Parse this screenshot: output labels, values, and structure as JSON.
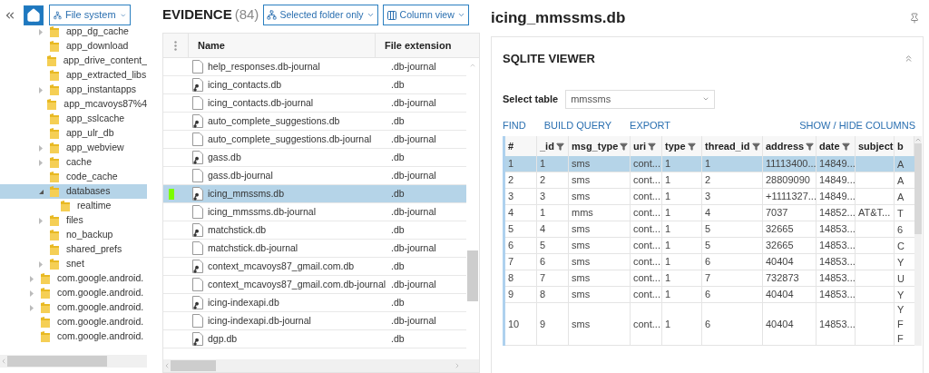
{
  "left_panel": {
    "view_selector": "File system",
    "tree": {
      "inner_items": [
        {
          "label": "app_dg_cache",
          "expandable": true,
          "expanded": false,
          "selected": false
        },
        {
          "label": "app_download",
          "expandable": false,
          "expanded": false,
          "selected": false
        },
        {
          "label": "app_drive_content_",
          "expandable": false,
          "expanded": false,
          "selected": false
        },
        {
          "label": "app_extracted_libs",
          "expandable": false,
          "expanded": false,
          "selected": false
        },
        {
          "label": "app_instantapps",
          "expandable": true,
          "expanded": false,
          "selected": false
        },
        {
          "label": "app_mcavoys87%4",
          "expandable": false,
          "expanded": false,
          "selected": false
        },
        {
          "label": "app_sslcache",
          "expandable": false,
          "expanded": false,
          "selected": false
        },
        {
          "label": "app_ulr_db",
          "expandable": false,
          "expanded": false,
          "selected": false
        },
        {
          "label": "app_webview",
          "expandable": true,
          "expanded": false,
          "selected": false
        },
        {
          "label": "cache",
          "expandable": true,
          "expanded": false,
          "selected": false
        },
        {
          "label": "code_cache",
          "expandable": false,
          "expanded": false,
          "selected": false
        },
        {
          "label": "databases",
          "expandable": true,
          "expanded": true,
          "selected": true,
          "children": [
            {
              "label": "realtime",
              "expandable": false,
              "expanded": false,
              "selected": false
            }
          ]
        },
        {
          "label": "files",
          "expandable": true,
          "expanded": false,
          "selected": false
        },
        {
          "label": "no_backup",
          "expandable": false,
          "expanded": false,
          "selected": false
        },
        {
          "label": "shared_prefs",
          "expandable": false,
          "expanded": false,
          "selected": false
        },
        {
          "label": "snet",
          "expandable": true,
          "expanded": false,
          "selected": false
        }
      ],
      "outer_items": [
        {
          "label": "com.google.android.",
          "expandable": true,
          "expanded": false,
          "selected": false
        },
        {
          "label": "com.google.android.",
          "expandable": true,
          "expanded": false,
          "selected": false
        },
        {
          "label": "com.google.android.",
          "expandable": true,
          "expanded": false,
          "selected": false
        },
        {
          "label": "com.google.android.",
          "expandable": false,
          "expanded": false,
          "selected": false
        },
        {
          "label": "com.google.android.",
          "expandable": false,
          "expanded": false,
          "selected": false
        }
      ]
    }
  },
  "evidence": {
    "title": "EVIDENCE",
    "count": "(84)",
    "scope_selector": "Selected folder only",
    "view_selector": "Column view",
    "columns": [
      "Name",
      "File extension"
    ],
    "rows": [
      {
        "name": "help_responses.db-journal",
        "extension": ".db-journal",
        "kind": "plain",
        "selected": false,
        "flagged": false
      },
      {
        "name": "icing_contacts.db",
        "extension": ".db",
        "kind": "database",
        "selected": false,
        "flagged": false
      },
      {
        "name": "icing_contacts.db-journal",
        "extension": ".db-journal",
        "kind": "plain",
        "selected": false,
        "flagged": false
      },
      {
        "name": "auto_complete_suggestions.db",
        "extension": ".db",
        "kind": "database",
        "selected": false,
        "flagged": false
      },
      {
        "name": "auto_complete_suggestions.db-journal",
        "extension": ".db-journal",
        "kind": "plain",
        "selected": false,
        "flagged": false
      },
      {
        "name": "gass.db",
        "extension": ".db",
        "kind": "database",
        "selected": false,
        "flagged": false
      },
      {
        "name": "gass.db-journal",
        "extension": ".db-journal",
        "kind": "plain",
        "selected": false,
        "flagged": false
      },
      {
        "name": "icing_mmssms.db",
        "extension": ".db",
        "kind": "database",
        "selected": true,
        "flagged": true
      },
      {
        "name": "icing_mmssms.db-journal",
        "extension": ".db-journal",
        "kind": "plain",
        "selected": false,
        "flagged": false
      },
      {
        "name": "matchstick.db",
        "extension": ".db",
        "kind": "database",
        "selected": false,
        "flagged": false
      },
      {
        "name": "matchstick.db-journal",
        "extension": ".db-journal",
        "kind": "plain",
        "selected": false,
        "flagged": false
      },
      {
        "name": "context_mcavoys87_gmail.com.db",
        "extension": ".db",
        "kind": "database",
        "selected": false,
        "flagged": false
      },
      {
        "name": "context_mcavoys87_gmail.com.db-journal",
        "extension": ".db-journal",
        "kind": "plain",
        "selected": false,
        "flagged": false
      },
      {
        "name": "icing-indexapi.db",
        "extension": ".db",
        "kind": "database",
        "selected": false,
        "flagged": false
      },
      {
        "name": "icing-indexapi.db-journal",
        "extension": ".db-journal",
        "kind": "plain",
        "selected": false,
        "flagged": false
      },
      {
        "name": "dgp.db",
        "extension": ".db",
        "kind": "database",
        "selected": false,
        "flagged": false
      }
    ]
  },
  "detail": {
    "title": "icing_mmssms.db",
    "viewer": {
      "title": "SQLITE VIEWER",
      "select_label": "Select table",
      "select_value": "mmssms",
      "actions": [
        "FIND",
        "BUILD QUERY",
        "EXPORT"
      ],
      "columns_action": "SHOW / HIDE COLUMNS",
      "columns": [
        "#",
        "_id",
        "msg_type",
        "uri",
        "type",
        "thread_id",
        "address",
        "date",
        "subject",
        "b"
      ],
      "rows": [
        {
          "cells": [
            "1",
            "1",
            "sms",
            "cont...",
            "1",
            "1",
            "11113400...",
            "14849...",
            ""
          ],
          "last": [
            "A"
          ],
          "selected": true
        },
        {
          "cells": [
            "2",
            "2",
            "sms",
            "cont...",
            "1",
            "2",
            "28809090",
            "14849...",
            ""
          ],
          "last": [
            "A"
          ],
          "selected": false
        },
        {
          "cells": [
            "3",
            "3",
            "sms",
            "cont...",
            "1",
            "3",
            "+1111327...",
            "14849...",
            ""
          ],
          "last": [
            "A"
          ],
          "selected": false
        },
        {
          "cells": [
            "4",
            "1",
            "mms",
            "cont...",
            "1",
            "4",
            "7037",
            "14852...",
            "AT&T..."
          ],
          "last": [
            "T"
          ],
          "selected": false
        },
        {
          "cells": [
            "5",
            "4",
            "sms",
            "cont...",
            "1",
            "5",
            "32665",
            "14853...",
            ""
          ],
          "last": [
            "6"
          ],
          "selected": false
        },
        {
          "cells": [
            "6",
            "5",
            "sms",
            "cont...",
            "1",
            "5",
            "32665",
            "14853...",
            ""
          ],
          "last": [
            "C"
          ],
          "selected": false
        },
        {
          "cells": [
            "7",
            "6",
            "sms",
            "cont...",
            "1",
            "6",
            "40404",
            "14853...",
            ""
          ],
          "last": [
            "Y"
          ],
          "selected": false
        },
        {
          "cells": [
            "8",
            "7",
            "sms",
            "cont...",
            "1",
            "7",
            "732873",
            "14853...",
            ""
          ],
          "last": [
            "U"
          ],
          "selected": false
        },
        {
          "cells": [
            "9",
            "8",
            "sms",
            "cont...",
            "1",
            "6",
            "40404",
            "14853...",
            ""
          ],
          "last": [
            "Y"
          ],
          "selected": false
        },
        {
          "cells": [
            "10",
            "9",
            "sms",
            "cont...",
            "1",
            "6",
            "40404",
            "14853...",
            ""
          ],
          "last": [
            "Y",
            "F",
            "F"
          ],
          "selected": false
        }
      ]
    }
  }
}
